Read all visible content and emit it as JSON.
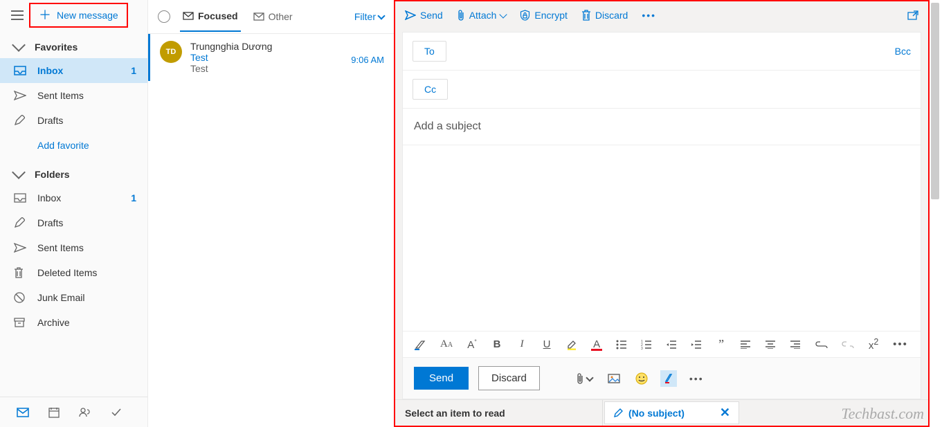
{
  "header": {
    "new_message": "New message"
  },
  "favorites": {
    "title": "Favorites",
    "items": [
      {
        "icon": "inbox",
        "label": "Inbox",
        "count": "1",
        "active": true
      },
      {
        "icon": "send",
        "label": "Sent Items"
      },
      {
        "icon": "draft",
        "label": "Drafts"
      }
    ],
    "add": "Add favorite"
  },
  "folders": {
    "title": "Folders",
    "items": [
      {
        "icon": "inbox",
        "label": "Inbox",
        "count": "1"
      },
      {
        "icon": "draft",
        "label": "Drafts"
      },
      {
        "icon": "send",
        "label": "Sent Items"
      },
      {
        "icon": "trash",
        "label": "Deleted Items"
      },
      {
        "icon": "junk",
        "label": "Junk Email"
      },
      {
        "icon": "archive",
        "label": "Archive"
      }
    ]
  },
  "list": {
    "tab_focused": "Focused",
    "tab_other": "Other",
    "filter": "Filter",
    "message": {
      "initials": "TD",
      "from": "Trungnghia Dương",
      "subject": "Test",
      "preview": "Test",
      "time": "9:06 AM"
    }
  },
  "compose": {
    "cmd": {
      "send": "Send",
      "attach": "Attach",
      "encrypt": "Encrypt",
      "discard": "Discard"
    },
    "to": "To",
    "cc": "Cc",
    "bcc": "Bcc",
    "subject_placeholder": "Add a subject",
    "send_button": "Send",
    "discard_button": "Discard"
  },
  "bottom": {
    "read_prompt": "Select an item to read",
    "draft_tab": "(No subject)"
  },
  "watermark": "Techbast.com"
}
